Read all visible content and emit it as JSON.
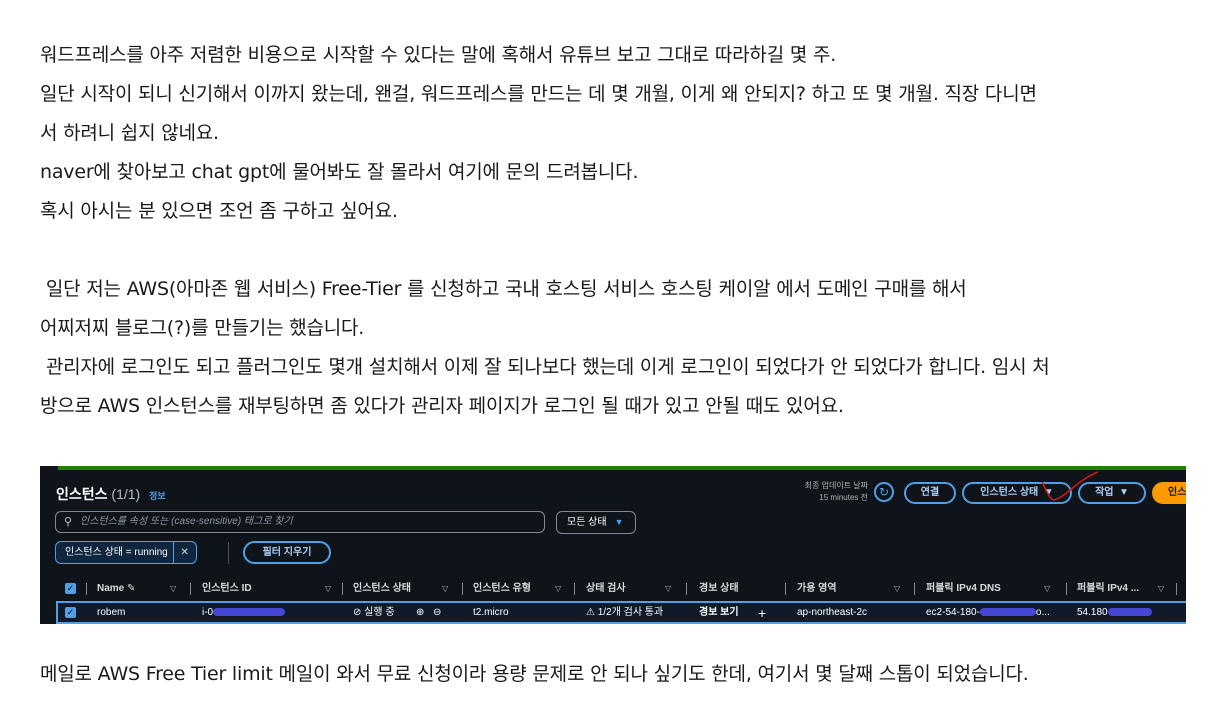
{
  "paragraph1": [
    "워드프레스를 아주 저렴한 비용으로 시작할 수 있다는 말에 혹해서 유튜브 보고 그대로 따라하길 몇 주.",
    "일단 시작이 되니 신기해서 이까지 왔는데, 왠걸, 워드프레스를 만드는 데 몇 개월, 이게 왜 안되지? 하고 또 몇 개월. 직장 다니면",
    "서 하려니 쉽지 않네요.",
    "naver에 찾아보고 chat gpt에 물어봐도 잘 몰라서 여기에 문의 드려봅니다.",
    "혹시 아시는 분 있으면 조언 좀 구하고 싶어요."
  ],
  "paragraph2": [
    " 일단 저는 AWS(아마존 웹 서비스) Free-Tier 를 신청하고 국내 호스팅 서비스 호스팅 케이알 에서 도메인 구매를 해서",
    "어찌저찌 블로그(?)를 만들기는 했습니다.",
    " 관리자에 로그인도 되고 플러그인도 몇개 설치해서 이제 잘 되나보다 했는데 이게 로그인이 되었다가 안 되었다가 합니다. 임시 처",
    "방으로 AWS 인스턴스를 재부팅하면 좀 있다가 관리자 페이지가 로그인 될 때가 있고 안될 때도 있어요."
  ],
  "paragraph3": "메일로 AWS Free Tier limit 메일이 와서 무료 신청이라 용량 문제로 안 되나 싶기도 한데, 여기서 몇 달째 스톱이 되었습니다.",
  "console": {
    "title": "인스턴스",
    "count": "(1/1)",
    "info": "정보",
    "last_updated_label": "최종 업데이트 날짜",
    "last_updated_value": "15 minutes 전",
    "buttons": {
      "connect": "연결",
      "instance_state": "인스턴스 상태",
      "actions": "작업",
      "launch": "인스"
    },
    "search_placeholder": "인스턴스를 속성 또는 (case-sensitive) 태그로 찾기",
    "state_select": "모든 상태",
    "filter_token": "인스턴스 상태 = running",
    "clear_filters": "필터 지우기",
    "columns": [
      "Name",
      "인스턴스 ID",
      "인스턴스 상태",
      "인스턴스 유형",
      "상태 검사",
      "경보 상태",
      "가용 영역",
      "퍼블릭 IPv4 DNS",
      "퍼블릭 IPv4 ..."
    ],
    "row": {
      "name": "robem",
      "id": "i-0",
      "state": "실행 중",
      "type": "t2.micro",
      "check": "1/2개 검사 통과",
      "alarm": "경보 보기",
      "az": "ap-northeast-2c",
      "dns": "ec2-54-180-",
      "dns_tail": "o...",
      "ip": "54.180"
    },
    "colors": {
      "accent": "#539fe5",
      "bg": "#0f141a",
      "success": "#29ad32",
      "warning": "#ff9900"
    }
  }
}
